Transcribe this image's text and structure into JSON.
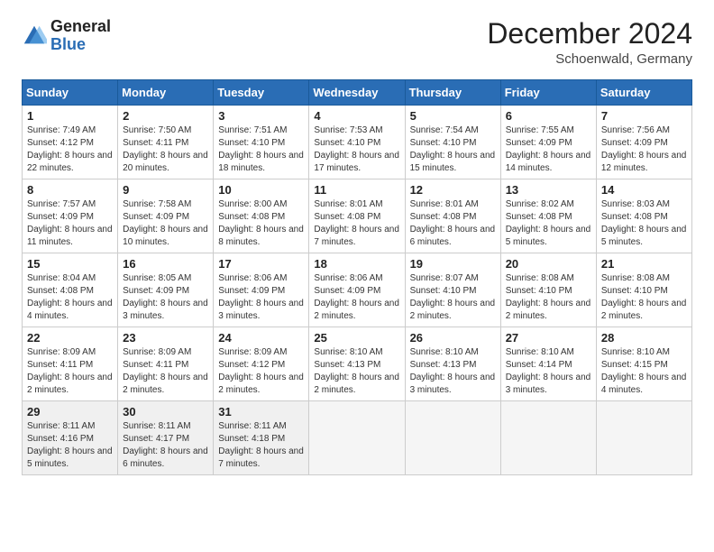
{
  "logo": {
    "general": "General",
    "blue": "Blue"
  },
  "header": {
    "month_year": "December 2024",
    "location": "Schoenwald, Germany"
  },
  "days_of_week": [
    "Sunday",
    "Monday",
    "Tuesday",
    "Wednesday",
    "Thursday",
    "Friday",
    "Saturday"
  ],
  "weeks": [
    [
      {
        "day": "1",
        "sunrise": "7:49 AM",
        "sunset": "4:12 PM",
        "daylight": "8 hours and 22 minutes."
      },
      {
        "day": "2",
        "sunrise": "7:50 AM",
        "sunset": "4:11 PM",
        "daylight": "8 hours and 20 minutes."
      },
      {
        "day": "3",
        "sunrise": "7:51 AM",
        "sunset": "4:10 PM",
        "daylight": "8 hours and 18 minutes."
      },
      {
        "day": "4",
        "sunrise": "7:53 AM",
        "sunset": "4:10 PM",
        "daylight": "8 hours and 17 minutes."
      },
      {
        "day": "5",
        "sunrise": "7:54 AM",
        "sunset": "4:10 PM",
        "daylight": "8 hours and 15 minutes."
      },
      {
        "day": "6",
        "sunrise": "7:55 AM",
        "sunset": "4:09 PM",
        "daylight": "8 hours and 14 minutes."
      },
      {
        "day": "7",
        "sunrise": "7:56 AM",
        "sunset": "4:09 PM",
        "daylight": "8 hours and 12 minutes."
      }
    ],
    [
      {
        "day": "8",
        "sunrise": "7:57 AM",
        "sunset": "4:09 PM",
        "daylight": "8 hours and 11 minutes."
      },
      {
        "day": "9",
        "sunrise": "7:58 AM",
        "sunset": "4:09 PM",
        "daylight": "8 hours and 10 minutes."
      },
      {
        "day": "10",
        "sunrise": "8:00 AM",
        "sunset": "4:08 PM",
        "daylight": "8 hours and 8 minutes."
      },
      {
        "day": "11",
        "sunrise": "8:01 AM",
        "sunset": "4:08 PM",
        "daylight": "8 hours and 7 minutes."
      },
      {
        "day": "12",
        "sunrise": "8:01 AM",
        "sunset": "4:08 PM",
        "daylight": "8 hours and 6 minutes."
      },
      {
        "day": "13",
        "sunrise": "8:02 AM",
        "sunset": "4:08 PM",
        "daylight": "8 hours and 5 minutes."
      },
      {
        "day": "14",
        "sunrise": "8:03 AM",
        "sunset": "4:08 PM",
        "daylight": "8 hours and 5 minutes."
      }
    ],
    [
      {
        "day": "15",
        "sunrise": "8:04 AM",
        "sunset": "4:08 PM",
        "daylight": "8 hours and 4 minutes."
      },
      {
        "day": "16",
        "sunrise": "8:05 AM",
        "sunset": "4:09 PM",
        "daylight": "8 hours and 3 minutes."
      },
      {
        "day": "17",
        "sunrise": "8:06 AM",
        "sunset": "4:09 PM",
        "daylight": "8 hours and 3 minutes."
      },
      {
        "day": "18",
        "sunrise": "8:06 AM",
        "sunset": "4:09 PM",
        "daylight": "8 hours and 2 minutes."
      },
      {
        "day": "19",
        "sunrise": "8:07 AM",
        "sunset": "4:10 PM",
        "daylight": "8 hours and 2 minutes."
      },
      {
        "day": "20",
        "sunrise": "8:08 AM",
        "sunset": "4:10 PM",
        "daylight": "8 hours and 2 minutes."
      },
      {
        "day": "21",
        "sunrise": "8:08 AM",
        "sunset": "4:10 PM",
        "daylight": "8 hours and 2 minutes."
      }
    ],
    [
      {
        "day": "22",
        "sunrise": "8:09 AM",
        "sunset": "4:11 PM",
        "daylight": "8 hours and 2 minutes."
      },
      {
        "day": "23",
        "sunrise": "8:09 AM",
        "sunset": "4:11 PM",
        "daylight": "8 hours and 2 minutes."
      },
      {
        "day": "24",
        "sunrise": "8:09 AM",
        "sunset": "4:12 PM",
        "daylight": "8 hours and 2 minutes."
      },
      {
        "day": "25",
        "sunrise": "8:10 AM",
        "sunset": "4:13 PM",
        "daylight": "8 hours and 2 minutes."
      },
      {
        "day": "26",
        "sunrise": "8:10 AM",
        "sunset": "4:13 PM",
        "daylight": "8 hours and 3 minutes."
      },
      {
        "day": "27",
        "sunrise": "8:10 AM",
        "sunset": "4:14 PM",
        "daylight": "8 hours and 3 minutes."
      },
      {
        "day": "28",
        "sunrise": "8:10 AM",
        "sunset": "4:15 PM",
        "daylight": "8 hours and 4 minutes."
      }
    ],
    [
      {
        "day": "29",
        "sunrise": "8:11 AM",
        "sunset": "4:16 PM",
        "daylight": "8 hours and 5 minutes."
      },
      {
        "day": "30",
        "sunrise": "8:11 AM",
        "sunset": "4:17 PM",
        "daylight": "8 hours and 6 minutes."
      },
      {
        "day": "31",
        "sunrise": "8:11 AM",
        "sunset": "4:18 PM",
        "daylight": "8 hours and 7 minutes."
      },
      null,
      null,
      null,
      null
    ]
  ]
}
